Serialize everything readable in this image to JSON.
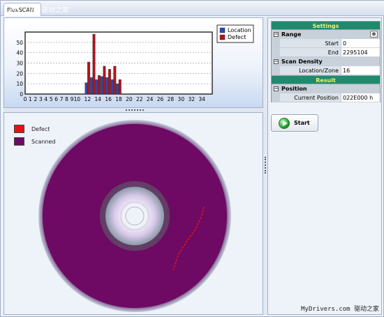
{
  "watermark_top": "ess.com 驱动之家",
  "tab": {
    "label": "PlexSCAN"
  },
  "chart_data": {
    "type": "bar",
    "title": "",
    "xlabel": "",
    "ylabel": "",
    "ylim": [
      0,
      60
    ],
    "xlim": [
      0,
      36
    ],
    "x_tick_labels": [
      "0",
      "1",
      "2",
      "3",
      "4",
      "5",
      "6",
      "7",
      "8",
      "9",
      "10",
      "12",
      "14",
      "16",
      "18",
      "20",
      "22",
      "24",
      "26",
      "28",
      "30",
      "32",
      "34"
    ],
    "y_tick_labels": [
      "0",
      "10",
      "20",
      "30",
      "40",
      "50"
    ],
    "x": [
      12,
      13,
      14,
      15,
      16,
      17,
      18
    ],
    "series": [
      {
        "name": "Location",
        "color": "#2a4aa8",
        "values": [
          11,
          16,
          14,
          17,
          16,
          14,
          10
        ]
      },
      {
        "name": "Defect",
        "color": "#b0141c",
        "values": [
          31,
          58,
          18,
          27,
          24,
          27,
          14
        ]
      }
    ],
    "legend_position": "top-right",
    "grid": true
  },
  "disc_legend": [
    {
      "label": "Defect",
      "color": "#e01414"
    },
    {
      "label": "Scanned",
      "color": "#6e0a63"
    }
  ],
  "settings": {
    "header": "Settings",
    "range": {
      "label": "Range",
      "sort_icon": "sort-icon",
      "start_label": "Start",
      "start_value": "0",
      "end_label": "End",
      "end_value": "2295104"
    },
    "density": {
      "label": "Scan Density",
      "zone_label": "Location/Zone",
      "zone_value": "16"
    }
  },
  "result": {
    "header": "Result",
    "position": {
      "label": "Position",
      "current_label": "Current Position",
      "current_value": "022E000  h"
    }
  },
  "start_button": {
    "label": "Start",
    "icon": "play-icon"
  },
  "watermark_bottom": "MyDrivers.com 驱动之家"
}
